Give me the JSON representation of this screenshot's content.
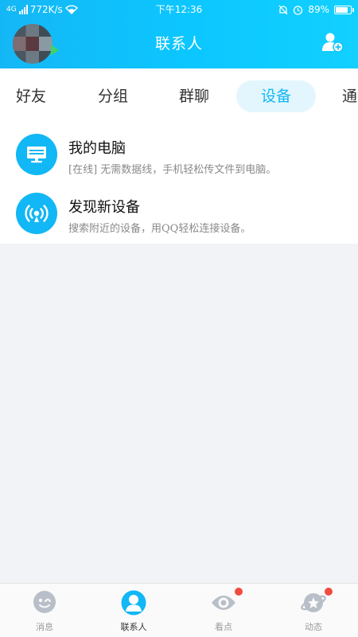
{
  "status_bar": {
    "network": "4G",
    "speed": "772K/s",
    "time": "下午12:36",
    "battery": "89%",
    "battery_level": 0.89
  },
  "header": {
    "title": "联系人",
    "add_icon": "add-contact-icon"
  },
  "tabs": [
    {
      "label": "好友",
      "active": false
    },
    {
      "label": "分组",
      "active": false
    },
    {
      "label": "群聊",
      "active": false
    },
    {
      "label": "设备",
      "active": true
    },
    {
      "label": "通",
      "active": false
    }
  ],
  "devices": [
    {
      "icon": "computer-icon",
      "title": "我的电脑",
      "subtitle": "[在线] 无需数据线，手机轻松传文件到电脑。"
    },
    {
      "icon": "radar-icon",
      "title": "发现新设备",
      "subtitle": "搜索附近的设备，用QQ轻松连接设备。"
    }
  ],
  "bottom_nav": [
    {
      "label": "消息",
      "icon": "chat-bubble-icon",
      "active": false,
      "badge": false
    },
    {
      "label": "联系人",
      "icon": "contacts-icon",
      "active": true,
      "badge": false
    },
    {
      "label": "看点",
      "icon": "eye-icon",
      "active": false,
      "badge": true
    },
    {
      "label": "动态",
      "icon": "planet-star-icon",
      "active": false,
      "badge": true
    }
  ],
  "colors": {
    "accent": "#12b7f5",
    "header_gradient_start": "#14b7f5",
    "header_gradient_end": "#12d0ff",
    "badge": "#f24b3f"
  }
}
